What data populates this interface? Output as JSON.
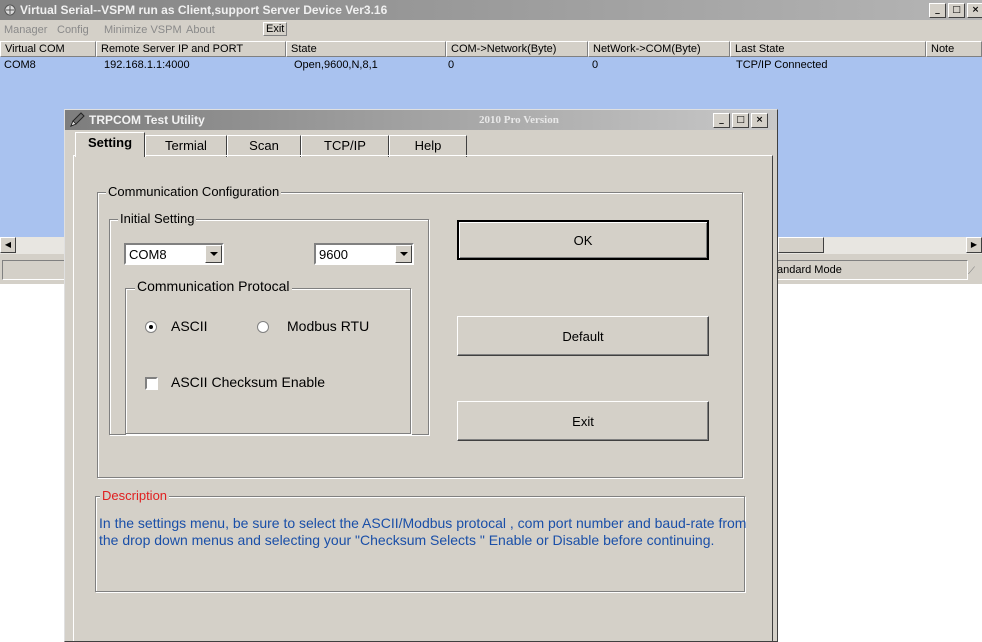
{
  "vspm": {
    "title": "Virtual Serial--VSPM run as Client,support Server Device  Ver3.16",
    "menu": [
      "Manager",
      "Config",
      "Minimize VSPM",
      "About",
      "Exit"
    ],
    "columns": [
      "Virtual COM",
      "Remote Server IP and PORT",
      "State",
      "COM->Network(Byte)",
      "NetWork->COM(Byte)",
      "Last State",
      "Note"
    ],
    "rows": [
      [
        "COM8",
        "192.168.1.1:4000",
        "Open,9600,N,8,1",
        "0",
        "0",
        "TCP/IP Connected",
        ""
      ]
    ],
    "status_right": "andard Mode",
    "selection_color": "#a9c2ef"
  },
  "trpcom": {
    "title": "TRPCOM Test Utility",
    "version": "2010 Pro Version",
    "tabs": [
      "Setting",
      "Termial",
      "Scan",
      "TCP/IP",
      "Help"
    ],
    "active_tab": "Setting",
    "comm_config_label": "Communication Configuration",
    "initial_setting_label": "Initial Setting",
    "com_port": "COM8",
    "baud_rate": "9600",
    "protocol_label": "Communication Protocal",
    "ascii_label": "ASCII",
    "modbus_label": "Modbus RTU",
    "ascii_selected": true,
    "checksum_label": "ASCII Checksum Enable",
    "checksum_checked": false,
    "ok_label": "OK",
    "default_label": "Default",
    "exit_label": "Exit",
    "description_label": "Description",
    "description_text": "In the settings menu, be sure to select the ASCII/Modbus protocal , com port number and baud-rate from the drop down menus and selecting your \"Checksum Selects \" Enable or Disable before continuing.",
    "description_label_color": "#e02020",
    "description_text_color": "#1a4fa8"
  },
  "icons": {
    "sysbuttons": [
      "minimize-icon",
      "maximize-icon",
      "close-icon"
    ]
  }
}
